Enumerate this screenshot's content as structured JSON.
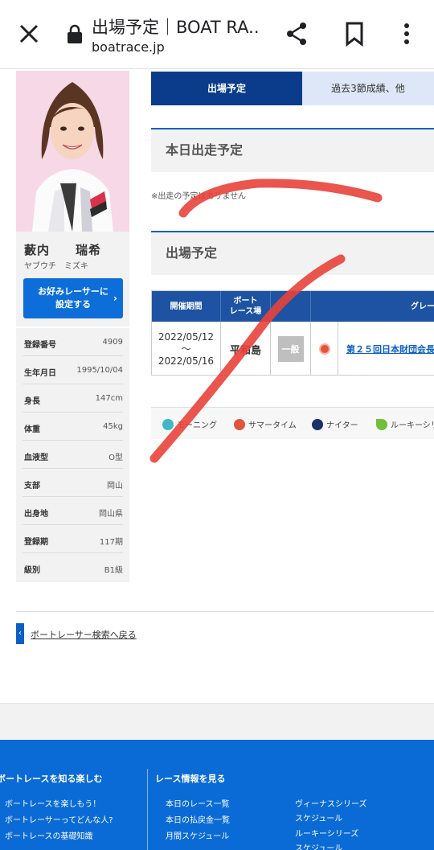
{
  "browser": {
    "title": "出場予定｜BOAT RA...",
    "url": "boatrace.jp"
  },
  "racer": {
    "name": "藪内　　瑞希",
    "kana": "ヤブウチ　ミズキ",
    "favorite_button": "お好みレーサーに\n設定する",
    "profile": [
      {
        "label": "登録番号",
        "value": "4909"
      },
      {
        "label": "生年月日",
        "value": "1995/10/04"
      },
      {
        "label": "身長",
        "value": "147cm"
      },
      {
        "label": "体重",
        "value": "45kg"
      },
      {
        "label": "血液型",
        "value": "O型"
      },
      {
        "label": "支部",
        "value": "岡山"
      },
      {
        "label": "出身地",
        "value": "岡山県"
      },
      {
        "label": "登録期",
        "value": "117期"
      },
      {
        "label": "級別",
        "value": "B1級"
      }
    ]
  },
  "tabs": {
    "active": "出場予定",
    "inactive": "過去3節成績、他"
  },
  "today": {
    "heading": "本日出走予定",
    "note": "※出走の予定はありません"
  },
  "schedule": {
    "heading": "出場予定",
    "columns": [
      "開催期間",
      "ボート\nレース場",
      "",
      "",
      "グレー"
    ],
    "row": {
      "period_start": "2022/05/12",
      "period_sep": "～",
      "period_end": "2022/05/16",
      "venue": "平和島",
      "grade": "一般",
      "race_name": "第２５回日本財団会長"
    }
  },
  "legend": [
    "モーニング",
    "サマータイム",
    "ナイター",
    "ルーキーシリーズ"
  ],
  "back_link": "ボートレーサー検索へ戻る",
  "footer": {
    "col1_heading": "ボートレースを知る楽しむ",
    "col1_links": [
      "ボートレースを楽しもう！",
      "ボートレーサーってどんな人?",
      "ボートレースの基礎知識"
    ],
    "col2_heading": "レース情報を見る",
    "col2_links": [
      "本日のレース一覧",
      "本日の払戻金一覧",
      "月間スケジュール"
    ],
    "col3_links": [
      "ヴィーナスシリーズ",
      "スケジュール",
      "ルーキーシリーズ",
      "スケジュール"
    ]
  },
  "colors": {
    "brand_navy": "#0b3c8c",
    "brand_blue": "#0b6bd6",
    "table_head": "#1e53a3",
    "annotation_red": "#e8423a"
  }
}
